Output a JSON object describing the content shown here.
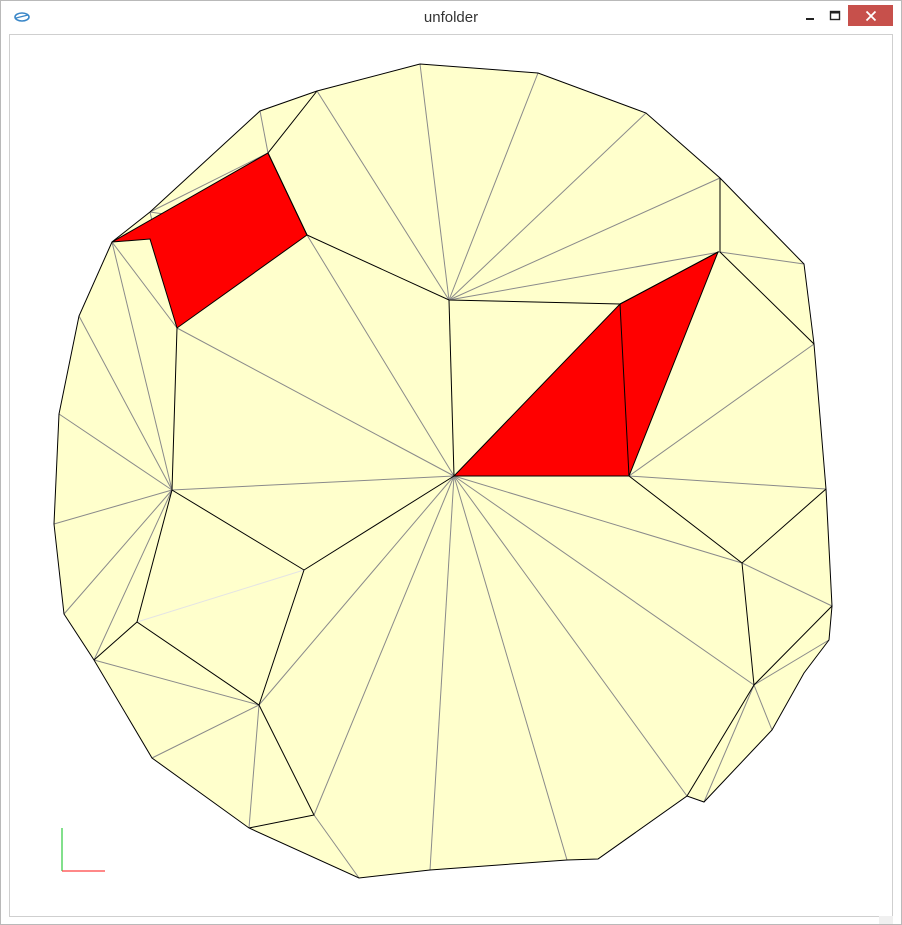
{
  "window": {
    "title": "unfolder",
    "controls": {
      "minimize_icon": "minimize-icon",
      "maximize_icon": "maximize-icon",
      "close_icon": "close-icon"
    }
  },
  "colors": {
    "face_fill": "#ffffcc",
    "selected_fill": "#ff0000",
    "cut_edge": "#000000",
    "fold_edge": "#8a8a8a",
    "axis_x": "#ff4040",
    "axis_y": "#2ecc40",
    "close_button": "#c7504b"
  },
  "icons": {
    "app": "unfolder-app-icon",
    "axis_gizmo": "xy-axis-icon"
  }
}
